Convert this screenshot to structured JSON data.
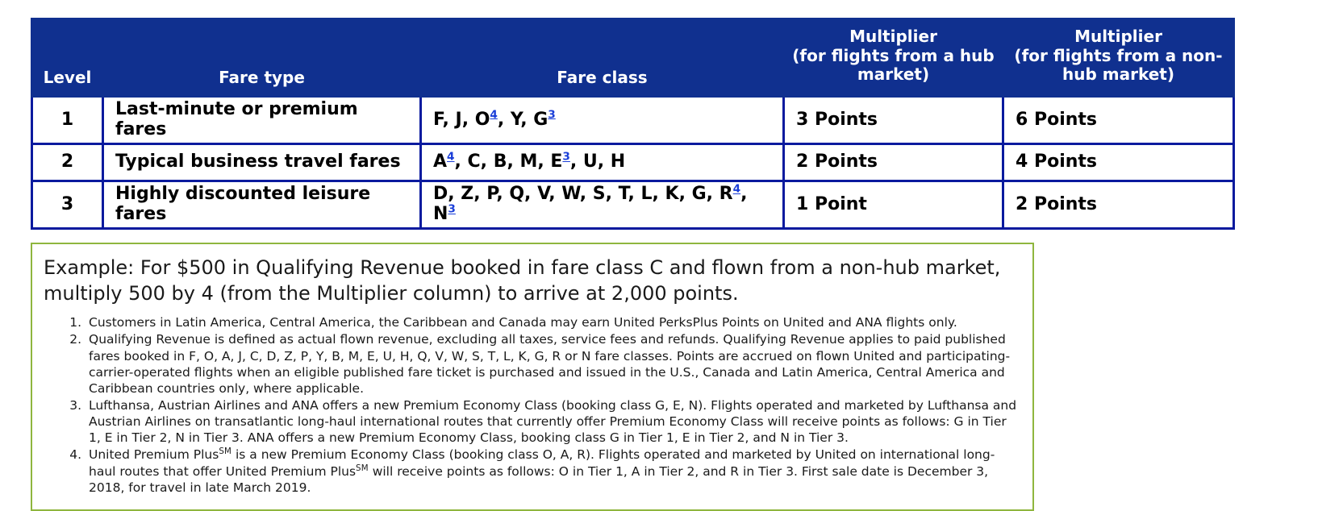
{
  "table": {
    "headers": {
      "level": "Level",
      "fare_type": "Fare type",
      "fare_class": "Fare class",
      "multiplier_hub_line1": "Multiplier",
      "multiplier_hub_line2": "(for flights from a hub market)",
      "multiplier_nonhub_line1": "Multiplier",
      "multiplier_nonhub_line2": "(for flights from a non-hub market)"
    },
    "rows": [
      {
        "level": "1",
        "fare_type": "Last-minute or premium fares",
        "fare_class_parts": [
          {
            "text": "F, J, O",
            "ref": null
          },
          {
            "text": "",
            "ref": "4"
          },
          {
            "text": ", Y, G",
            "ref": null
          },
          {
            "text": "",
            "ref": "3"
          }
        ],
        "fare_class_plain": "F, J, O4, Y, G3",
        "multiplier_hub": "3 Points",
        "multiplier_nonhub": "6 Points"
      },
      {
        "level": "2",
        "fare_type": "Typical business travel fares",
        "fare_class_parts": [
          {
            "text": "A",
            "ref": null
          },
          {
            "text": "",
            "ref": "4"
          },
          {
            "text": ", C, B, M, E",
            "ref": null
          },
          {
            "text": "",
            "ref": "3"
          },
          {
            "text": ", U, H",
            "ref": null
          }
        ],
        "fare_class_plain": "A4, C, B, M, E3, U, H",
        "multiplier_hub": "2 Points",
        "multiplier_nonhub": "4 Points"
      },
      {
        "level": "3",
        "fare_type": "Highly discounted leisure fares",
        "fare_class_parts": [
          {
            "text": "D, Z, P, Q, V, W, S, T, L, K, G, R",
            "ref": null
          },
          {
            "text": "",
            "ref": "4"
          },
          {
            "text": ", N",
            "ref": null
          },
          {
            "text": "",
            "ref": "3"
          }
        ],
        "fare_class_plain": "D, Z, P, Q, V, W, S, T, L, K, G, R4, N3",
        "multiplier_hub": "1 Point",
        "multiplier_nonhub": "2 Points"
      }
    ]
  },
  "example": {
    "text": "Example: For $500 in Qualifying Revenue booked in fare class C and flown from a non-hub market, multiply 500 by 4 (from the Multiplier column) to arrive at 2,000 points.",
    "footnotes": [
      "Customers in Latin America, Central America, the Caribbean and Canada may earn United PerksPlus Points on United and ANA flights only.",
      "Qualifying Revenue is defined as actual flown revenue, excluding all taxes, service fees and refunds. Qualifying Revenue applies to paid published fares booked in F, O, A, J, C, D, Z, P, Y, B, M, E, U, H, Q, V, W, S, T, L, K, G, R or N fare classes. Points are accrued on flown United and participating-carrier-operated flights when an eligible published fare ticket is purchased and issued in the U.S., Canada and Latin America, Central America and Caribbean countries only, where applicable.",
      "Lufthansa, Austrian Airlines and ANA offers a new Premium Economy Class (booking class G, E, N). Flights operated and marketed by Lufthansa and Austrian Airlines on transatlantic long-haul international routes that currently offer Premium Economy Class will receive points as follows: G in Tier 1, E in Tier 2, N in Tier 3. ANA offers a new Premium Economy Class, booking class G in Tier 1, E in Tier 2, and N in Tier 3.",
      "United Premium Plus℠ is a new Premium Economy Class (booking class O, A, R). Flights operated and marketed by United on international long-haul routes that offer United Premium Plus℠ will receive points as follows: O in Tier 1, A in Tier 2, and R in Tier 3. First sale date is December 3, 2018, for travel in late March 2019."
    ]
  },
  "colors": {
    "header_blue": "#10308f",
    "border_blue": "#0a1a9e",
    "footnote_link": "#1a3ed8",
    "example_border_green": "#8fb63e"
  }
}
